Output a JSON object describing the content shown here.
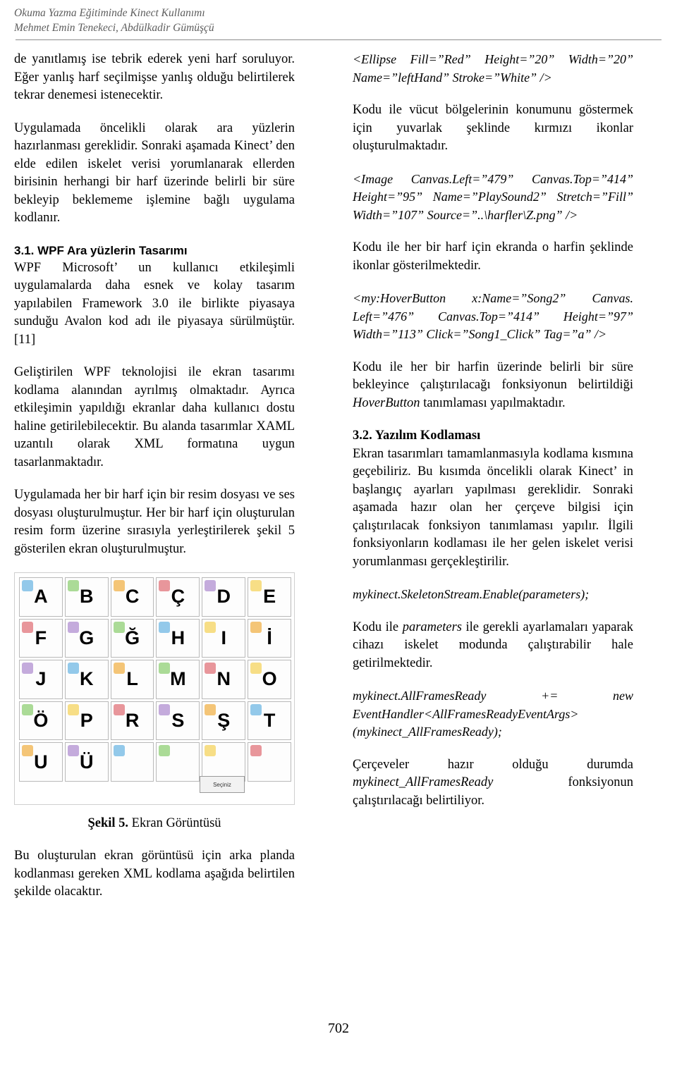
{
  "header": {
    "line1": "Okuma Yazma Eğitiminde Kinect Kullanımı",
    "line2": "Mehmet Emin Tenekeci, Abdülkadir Gümüşçü"
  },
  "page_number": "702",
  "left_column": {
    "p1": "de yanıtlamış ise tebrik ederek yeni harf soruluyor. Eğer yanlış harf seçilmişse yanlış olduğu belirtilerek tekrar denemesi istenecektir.",
    "p2": "Uygulamada öncelikli olarak ara yüzlerin hazırlanması gereklidir. Sonraki aşamada Kinect’ den elde edilen iskelet verisi yorumlanarak ellerden birisinin herhangi bir harf üzerinde belirli bir süre bekleyip beklememe işlemine bağlı uygulama kodlanır.",
    "heading_3_1": "3.1. WPF Ara yüzlerin Tasarımı",
    "p3": "WPF Microsoft’ un kullanıcı etkileşimli uygulamalarda daha esnek ve kolay tasarım yapılabilen Framework 3.0 ile birlikte piyasaya sunduğu Avalon kod adı ile piyasaya sürülmüştür. [11]",
    "p4": "Geliştirilen WPF teknolojisi ile ekran tasarımı kodlama alanından ayrılmış olmaktadır. Ayrıca etkileşimin yapıldığı ekranlar daha kullanıcı dostu haline getirilebilecektir. Bu alanda tasarımlar XAML uzantılı olarak XML formatına uygun tasarlanmaktadır.",
    "p5": "Uygulamada her bir harf için bir resim dosyası ve ses dosyası oluşturulmuştur. Her bir harf için oluşturulan resim form üzerine sırasıyla yerleştirilerek şekil 5 gösterilen ekran oluşturulmuştur.",
    "figure": {
      "caption_bold": "Şekil 5.",
      "caption_rest": " Ekran Görüntüsü",
      "tooltip": "Seçiniz",
      "letters": [
        "A",
        "B",
        "C",
        "Ç",
        "D",
        "E",
        "F",
        "G",
        "Ğ",
        "H",
        "I",
        "İ",
        "J",
        "K",
        "L",
        "M",
        "N",
        "O",
        "Ö",
        "P",
        "R",
        "S",
        "Ş",
        "T",
        "U",
        "Ü"
      ]
    },
    "p6": "Bu oluşturulan ekran görüntüsü için arka planda kodlanması gereken XML kodlama aşağıda belirtilen şekilde olacaktır."
  },
  "right_column": {
    "code1": "<Ellipse Fill=”Red” Height=”20” Width=”20” Name=”leftHand” Stroke=”White” />",
    "p1": "Kodu ile vücut bölgelerinin konumunu göstermek için yuvarlak şeklinde kırmızı ikonlar oluşturulmaktadır.",
    "code2": "<Image Canvas.Left=”479” Canvas.Top=”414” Height=”95” Name=”PlaySound2” Stretch=”Fill” Width=”107” Source=”..\\harfler\\Z.png” />",
    "p2": "Kodu ile her bir harf için ekranda o harfin şeklinde ikonlar gösterilmektedir.",
    "code3": "<my:HoverButton x:Name=”Song2” Canvas. Left=”476” Canvas.Top=”414” Height=”97” Width=”113” Click=”Song1_Click” Tag=”a” />",
    "p3_part1": "Kodu ile her bir harfin üzerinde belirli bir süre bekleyince çalıştırılacağı fonksiyonun belirtildiği ",
    "p3_em": "HoverButton",
    "p3_part2": " tanımlaması yapılmaktadır.",
    "heading_3_2": "3.2. Yazılım Kodlaması",
    "p4": "Ekran tasarımları tamamlanmasıyla kodlama kısmına geçebiliriz. Bu kısımda öncelikli olarak Kinect’ in başlangıç ayarları yapılması gereklidir. Sonraki aşamada hazır olan her çerçeve bilgisi için çalıştırılacak fonksiyon tanımlaması yapılır. İlgili fonksiyonların kodlaması ile her gelen iskelet verisi yorumlanması gerçekleştirilir.",
    "code4": "mykinect.SkeletonStream.Enable(parameters);",
    "p5_part1": "Kodu ile ",
    "p5_em": "parameters",
    "p5_part2": " ile gerekli ayarlamaları yaparak cihazı iskelet modunda çalıştırabilir hale getirilmektedir.",
    "code5": "mykinect.AllFramesReady += new EventHandler<AllFramesReadyEventArgs>(mykinect_AllFramesReady);",
    "p6_part1": "Çerçeveler hazır olduğu durumda ",
    "p6_em": "mykinect_AllFramesReady",
    "p6_part2": " fonksiyonun çalıştırılacağı belirtiliyor."
  }
}
